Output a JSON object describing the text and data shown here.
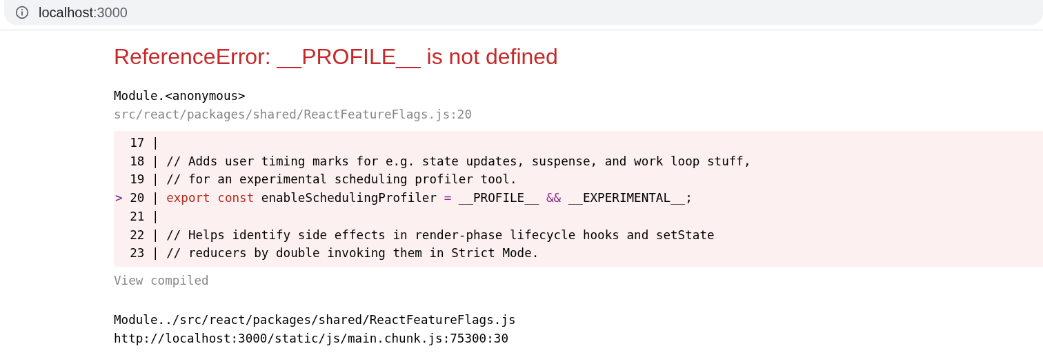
{
  "address_bar": {
    "host": "localhost",
    "port": ":3000"
  },
  "error": {
    "title": "ReferenceError: __PROFILE__ is not defined",
    "frame": {
      "function": "Module.<anonymous>",
      "location": "src/react/packages/shared/ReactFeatureFlags.js:20"
    },
    "code_lines": [
      {
        "number": "17"
      },
      {
        "number": "18",
        "tokens": [
          {
            "kind": "comment",
            "text": "// Adds user timing marks for e.g. state updates, suspense, and work loop stuff,"
          }
        ]
      },
      {
        "number": "19",
        "tokens": [
          {
            "kind": "comment",
            "text": "// for an experimental scheduling profiler tool."
          }
        ]
      },
      {
        "number": "20",
        "marker": ">",
        "tokens": [
          {
            "kind": "keyword",
            "text": "export const"
          },
          {
            "kind": "plain",
            "text": " enableSchedulingProfiler "
          },
          {
            "kind": "operator",
            "text": "="
          },
          {
            "kind": "plain",
            "text": " __PROFILE__ "
          },
          {
            "kind": "operator",
            "text": "&&"
          },
          {
            "kind": "plain",
            "text": " __EXPERIMENTAL__;"
          }
        ]
      },
      {
        "number": "21"
      },
      {
        "number": "22",
        "tokens": [
          {
            "kind": "comment",
            "text": "// Helps identify side effects in render-phase lifecycle hooks and setState"
          }
        ]
      },
      {
        "number": "23",
        "tokens": [
          {
            "kind": "comment",
            "text": "// reducers by double invoking them in Strict Mode."
          }
        ]
      }
    ],
    "separator": "|",
    "view_compiled": "View compiled",
    "second_frame": {
      "function": "Module../src/react/packages/shared/ReactFeatureFlags.js",
      "location": "http://localhost:3000/static/js/main.chunk.js:75300:30"
    }
  }
}
